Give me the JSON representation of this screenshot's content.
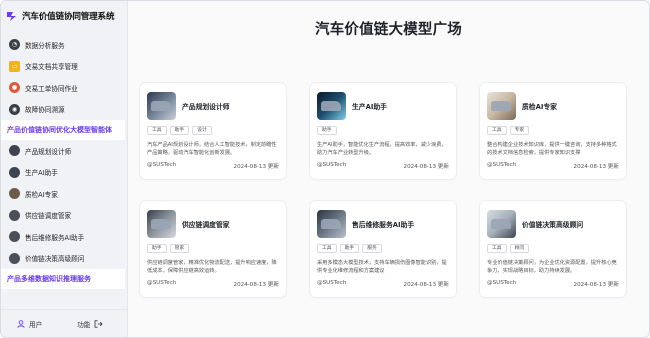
{
  "app": {
    "title": "汽车价值链协同管理系统"
  },
  "sidebar": {
    "items_top": [
      {
        "label": "数据分析服务",
        "icon": "chart-icon",
        "color": "#3b3f46"
      },
      {
        "label": "交易文档共享管理",
        "icon": "folder-icon",
        "color": "#f5b31b"
      },
      {
        "label": "交易工单协同作业",
        "icon": "team-icon",
        "color": "#e05a3c"
      },
      {
        "label": "故障协同溯源",
        "icon": "trace-icon",
        "color": "#3b3f46"
      }
    ],
    "section1": "产品价值链协同优化大模型智能体",
    "items_mid": [
      {
        "label": "产品规划设计师",
        "icon": "avatar-icon",
        "color": "#3d4450"
      },
      {
        "label": "生产AI助手",
        "icon": "avatar-icon",
        "color": "#3d4450"
      },
      {
        "label": "质检AI专家",
        "icon": "avatar-icon",
        "color": "#6b5c4a"
      },
      {
        "label": "供应链调度管家",
        "icon": "avatar-icon",
        "color": "#4b4f57"
      },
      {
        "label": "售后维修服务AI助手",
        "icon": "avatar-icon",
        "color": "#4b4f57"
      },
      {
        "label": "价值链决策高级顾问",
        "icon": "avatar-icon",
        "color": "#4b4f57"
      }
    ],
    "section2": "产品多维数据知识推理服务",
    "footer": {
      "user_label": "用户",
      "func_label": "功能"
    }
  },
  "main": {
    "title": "汽车价值链大模型广场",
    "cards": [
      {
        "title": "产品规划设计师",
        "tags": [
          "工具",
          "助手",
          "设计"
        ],
        "desc": "汽车产品AI规划设计师，结合人工智能技术，制定前瞻性产品策略，驱动汽车智能化创新发展。",
        "author": "@SUSTech",
        "date": "2024-08-13 更新"
      },
      {
        "title": "生产AI助手",
        "tags": [
          "助手"
        ],
        "desc": "生产AI助手，智能优化生产流程，提高效率，减少浪费，助力汽车产业转型升级。",
        "author": "@SUSTech",
        "date": "2024-08-13 更新"
      },
      {
        "title": "质检AI专家",
        "tags": [
          "工具",
          "专家"
        ],
        "desc": "整合构建企业技术知识库，提供一键咨询，支持多种格式的技术文档信息检索，提供专家知识支撑",
        "author": "@SUSTech",
        "date": "2024-08-13 更新"
      },
      {
        "title": "供应链调度管家",
        "tags": [
          "助手",
          "管家"
        ],
        "desc": "供应链调度管家，精准优化物流配送，提升响应速度，降低成本，保障供应链高效运转。",
        "author": "@SUSTech",
        "date": "2024-08-13 更新"
      },
      {
        "title": "售后维修服务AI助手",
        "tags": [
          "工具",
          "助手",
          "服务"
        ],
        "desc": "采用多模态大模型技术，支持车辆损伤图像智能识别，提供专业化维修流程和方案建议",
        "author": "@SUSTech",
        "date": "2024-08-13 更新"
      },
      {
        "title": "价值链决策高级顾问",
        "tags": [
          "工具",
          "顾问"
        ],
        "desc": "专业价值链决策顾问，为企业优化资源配置，提升核心竞争力，实现战略目标，助力持续发展。",
        "author": "@SUSTech",
        "date": "2024-08-13 更新"
      }
    ]
  }
}
